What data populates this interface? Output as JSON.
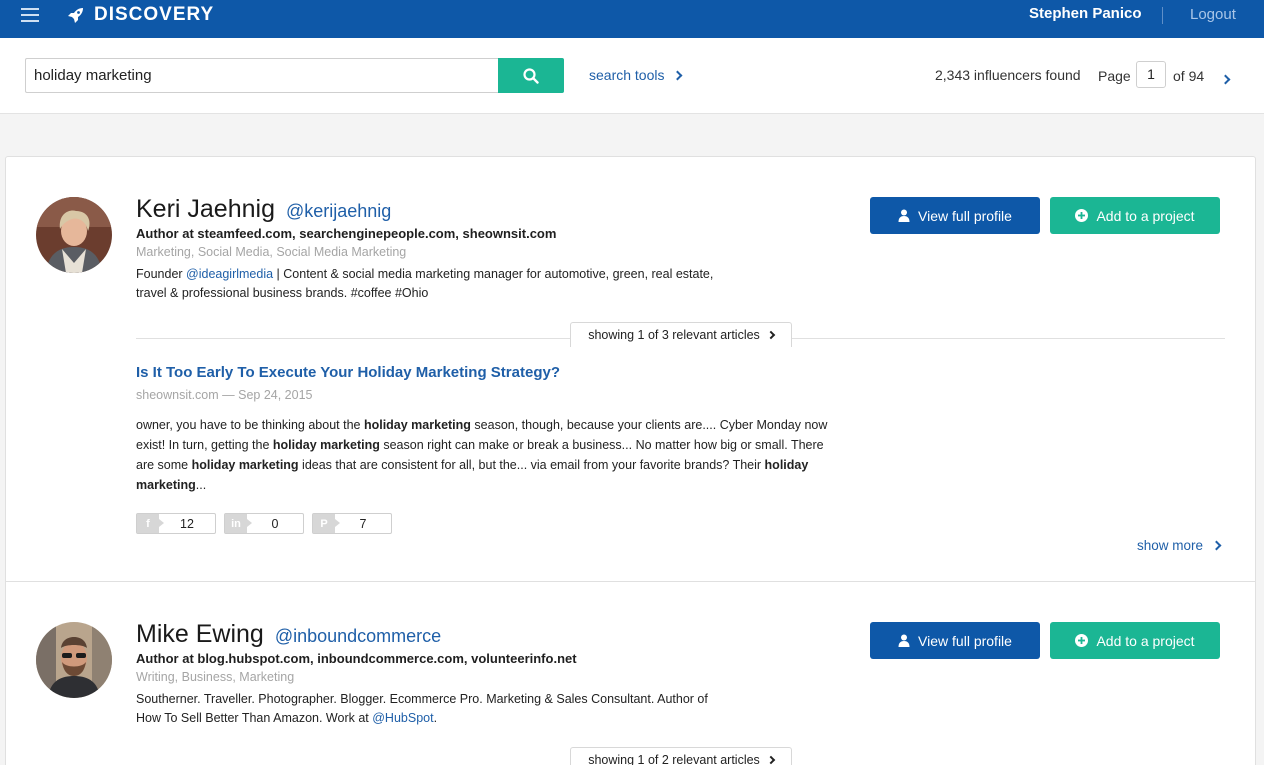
{
  "header": {
    "brand": "DISCOVERY",
    "user_name": "Stephen Panico",
    "logout": "Logout"
  },
  "search": {
    "query": "holiday marketing",
    "tools_label": "search tools",
    "found": "2,343 influencers found",
    "page_label": "Page",
    "page_current": "1",
    "page_of": "of 94"
  },
  "influencers": [
    {
      "name": "Keri Jaehnig",
      "handle": "@kerijaehnig",
      "author": "Author at steamfeed.com, searchenginepeople.com, sheownsit.com",
      "topics": "Marketing, Social Media, Social Media Marketing",
      "bio_prefix": "Founder ",
      "bio_link": "@ideagirlmedia",
      "bio_line1_rest": " | Content & social media marketing manager for automotive, green, real estate,",
      "bio_line2": "travel & professional business brands. #coffee #Ohio",
      "view_profile": "View full profile",
      "add_project": "Add to a project",
      "articles_summary": "showing 1 of 3 relevant articles",
      "article": {
        "title": "Is It Too Early To Execute Your Holiday Marketing Strategy?",
        "source": "sheownsit.com — Sep 24, 2015",
        "snippet": [
          {
            "t": "owner, you have to be thinking about the ",
            "b": false
          },
          {
            "t": "holiday marketing",
            "b": true
          },
          {
            "t": " season, though, because your clients are.... Cyber Monday now exist!  In turn, getting the ",
            "b": false
          },
          {
            "t": "holiday marketing",
            "b": true
          },
          {
            "t": " season right can make or break a business... No matter how big or small. There are some ",
            "b": false
          },
          {
            "t": "holiday marketing",
            "b": true
          },
          {
            "t": " ideas that are consistent for all, but the... via email from your favorite brands?  Their ",
            "b": false
          },
          {
            "t": "holiday marketing",
            "b": true
          },
          {
            "t": "...",
            "b": false
          }
        ],
        "shares": [
          {
            "network": "facebook-icon",
            "glyph": "f",
            "count": "12"
          },
          {
            "network": "linkedin-icon",
            "glyph": "in",
            "count": "0"
          },
          {
            "network": "pinterest-icon",
            "glyph": "P",
            "count": "7"
          }
        ]
      },
      "show_more": "show more"
    },
    {
      "name": "Mike Ewing",
      "handle": "@inboundcommerce",
      "author": "Author at blog.hubspot.com, inboundcommerce.com, volunteerinfo.net",
      "topics": "Writing, Business, Marketing",
      "bio_line1": "Southerner. Traveller. Photographer. Blogger. Ecommerce Pro. Marketing & Sales Consultant. Author of",
      "bio_line2_prefix": "How To Sell Better Than Amazon. Work at ",
      "bio_link": "@HubSpot",
      "bio_line2_suffix": ".",
      "view_profile": "View full profile",
      "add_project": "Add to a project",
      "articles_summary": "showing 1 of 2 relevant articles"
    }
  ],
  "colors": {
    "brand_blue": "#0e58a8",
    "accent_green": "#1bb694",
    "link_blue": "#1f5fa8"
  }
}
